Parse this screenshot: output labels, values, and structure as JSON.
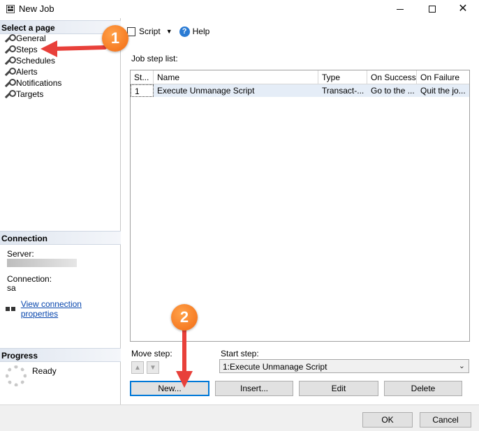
{
  "window": {
    "title": "New Job"
  },
  "left": {
    "select_page_header": "Select a page",
    "pages": [
      {
        "label": "General",
        "icon": "wrench-icon"
      },
      {
        "label": "Steps",
        "icon": "wrench-icon"
      },
      {
        "label": "Schedules",
        "icon": "wrench-icon"
      },
      {
        "label": "Alerts",
        "icon": "wrench-icon"
      },
      {
        "label": "Notifications",
        "icon": "wrench-icon"
      },
      {
        "label": "Targets",
        "icon": "wrench-icon"
      }
    ],
    "connection_header": "Connection",
    "server_label": "Server:",
    "connection_label": "Connection:",
    "connection_value": "sa",
    "view_connection_link": "View connection properties",
    "progress_header": "Progress",
    "progress_status": "Ready"
  },
  "toolbar": {
    "script_label": "Script",
    "help_label": "Help"
  },
  "main": {
    "job_step_list_label": "Job step list:",
    "columns": [
      "St...",
      "Name",
      "Type",
      "On Success",
      "On Failure"
    ],
    "rows": [
      {
        "step": "1",
        "name": "Execute Unmanage Script",
        "type": "Transact-...",
        "on_success": "Go to the ...",
        "on_failure": "Quit the jo..."
      }
    ],
    "move_step_label": "Move step:",
    "start_step_label": "Start step:",
    "start_step_value": "1:Execute Unmanage Script",
    "buttons": {
      "new": "New...",
      "insert": "Insert...",
      "edit": "Edit",
      "delete": "Delete"
    }
  },
  "footer": {
    "ok": "OK",
    "cancel": "Cancel"
  },
  "annotations": {
    "callout_1": "1",
    "callout_2": "2",
    "accent_color": "#f26a12",
    "arrow_color": "#e8403a"
  }
}
